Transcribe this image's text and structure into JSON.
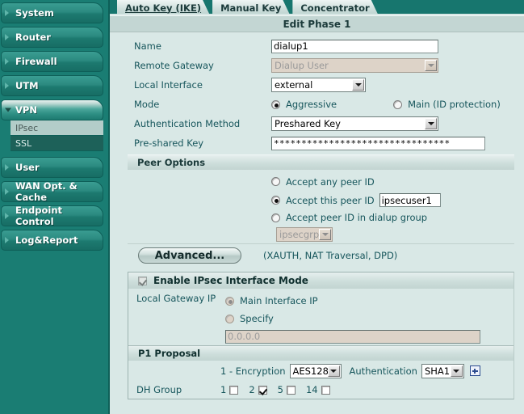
{
  "sidebar": {
    "items": [
      {
        "label": "System",
        "expanded": false,
        "selected": false
      },
      {
        "label": "Router",
        "expanded": false,
        "selected": false
      },
      {
        "label": "Firewall",
        "expanded": false,
        "selected": false
      },
      {
        "label": "UTM",
        "expanded": false,
        "selected": false
      },
      {
        "label": "VPN",
        "expanded": true,
        "selected": true,
        "children": [
          {
            "label": "IPsec",
            "active": true
          },
          {
            "label": "SSL",
            "active": false
          }
        ]
      },
      {
        "label": "User",
        "expanded": false,
        "selected": false
      },
      {
        "label": "WAN Opt. & Cache",
        "expanded": false,
        "selected": false
      },
      {
        "label": "Endpoint Control",
        "expanded": false,
        "selected": false
      },
      {
        "label": "Log&Report",
        "expanded": false,
        "selected": false
      }
    ]
  },
  "tabs": [
    {
      "label": "Auto Key (IKE)",
      "active": true
    },
    {
      "label": "Manual Key",
      "active": false
    },
    {
      "label": "Concentrator",
      "active": false
    }
  ],
  "page_title": "Edit Phase 1",
  "form": {
    "name_label": "Name",
    "name_value": "dialup1",
    "remote_gateway_label": "Remote Gateway",
    "remote_gateway_value": "Dialup User",
    "local_interface_label": "Local Interface",
    "local_interface_value": "external",
    "mode_label": "Mode",
    "mode_aggressive_label": "Aggressive",
    "mode_main_label": "Main (ID protection)",
    "auth_method_label": "Authentication Method",
    "auth_method_value": "Preshared Key",
    "preshared_key_label": "Pre-shared Key",
    "preshared_key_value": "********************************"
  },
  "peer_options": {
    "header": "Peer Options",
    "accept_any_label": "Accept any peer ID",
    "accept_this_label": "Accept this peer ID",
    "accept_this_value": "ipsecuser1",
    "accept_group_label": "Accept peer ID in dialup group",
    "group_value": "ipsecgrp"
  },
  "advanced": {
    "button_label": "Advanced...",
    "hint": "(XAUTH, NAT Traversal, DPD)"
  },
  "ipsec_panel": {
    "header": "Enable IPsec Interface Mode",
    "local_gateway_label": "Local Gateway IP",
    "main_interface_label": "Main Interface IP",
    "specify_label": "Specify",
    "specify_value": "0.0.0.0"
  },
  "p1_proposal": {
    "header": "P1 Proposal",
    "row_label": "1 - Encryption",
    "encryption_value": "AES128",
    "auth_label": "Authentication",
    "auth_value": "SHA1",
    "add_icon": "plus-box-icon",
    "dh_group_label": "DH Group",
    "dh_groups": [
      {
        "label": "1",
        "checked": false
      },
      {
        "label": "2",
        "checked": true
      },
      {
        "label": "5",
        "checked": false
      },
      {
        "label": "14",
        "checked": false
      }
    ]
  },
  "colors": {
    "sidebar_teal": "#1a7d73",
    "content_bg": "#d9e8e6",
    "label_text": "#17565c",
    "header_bar": "#c3d6d3"
  }
}
